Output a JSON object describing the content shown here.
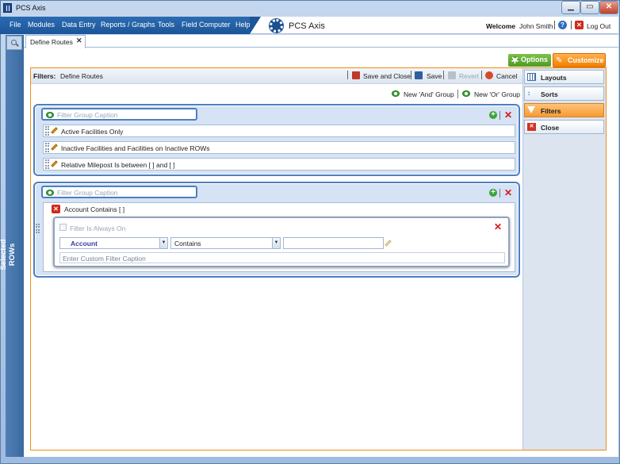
{
  "window": {
    "title": "PCS Axis"
  },
  "menu": [
    "File",
    "Modules",
    "Data Entry",
    "Reports / Graphs",
    "Tools",
    "Field Computer",
    "Help"
  ],
  "brand": {
    "name": "PCS Axis"
  },
  "user": {
    "welcome": "Welcome",
    "name": "John Smith",
    "logout": "Log Out"
  },
  "sidebar": {
    "label": "Selected ROWs"
  },
  "tabs": [
    {
      "label": "Define Routes",
      "close": "✕"
    }
  ],
  "top_buttons": {
    "options": "Options",
    "customize": "Customize"
  },
  "filterbar": {
    "label": "Filters:",
    "name": "Define Routes",
    "save_close": "Save and Close",
    "save": "Save",
    "revert": "Revert",
    "cancel": "Cancel"
  },
  "group_actions": {
    "new_and": "New 'And' Group",
    "new_or": "New 'Or' Group"
  },
  "group1": {
    "placeholder": "Filter Group Caption",
    "rows": [
      "Active Facilities Only",
      "Inactive Facilities and Facilities on Inactive ROWs",
      "Relative Milepost Is between [            ] and [            ]"
    ]
  },
  "group2": {
    "placeholder": "Filter Group Caption",
    "rows": [
      "Account Contains [            ]"
    ],
    "editor": {
      "always_on_label": "Filter Is Always On",
      "field": "Account",
      "operator": "Contains",
      "value": "",
      "caption_placeholder": "Enter Custom Filter Caption"
    }
  },
  "right_panel": [
    "Layouts",
    "Sorts",
    "Filters",
    "Close"
  ],
  "colors": {
    "accent_orange": "#f27f00",
    "options_green": "#4c9a23",
    "group_border": "#4d7fc1",
    "menu_blue": "#1c5598"
  }
}
